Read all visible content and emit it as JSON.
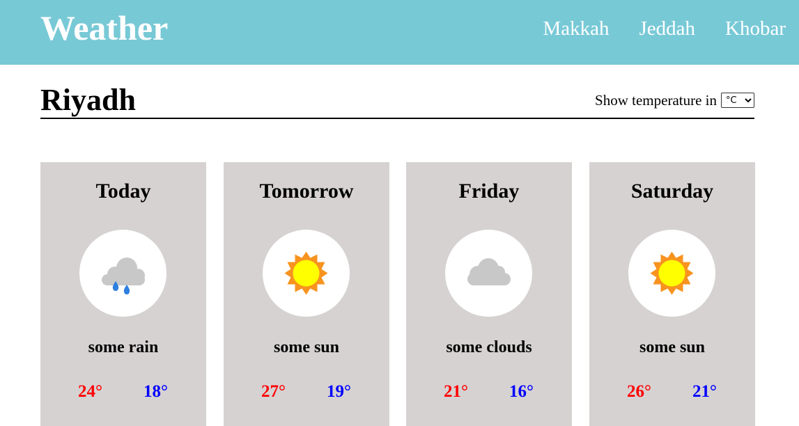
{
  "header": {
    "logo": "Weather",
    "nav": [
      "Makkah",
      "Jeddah",
      "Khobar"
    ]
  },
  "city": {
    "name": "Riyadh",
    "unit_label": "Show temperature in",
    "unit_selected": "°C"
  },
  "forecast": [
    {
      "day": "Today",
      "icon": "rain-cloud-icon",
      "desc": "some rain",
      "high": "24°",
      "low": "18°"
    },
    {
      "day": "Tomorrow",
      "icon": "sun-icon",
      "desc": "some sun",
      "high": "27°",
      "low": "19°"
    },
    {
      "day": "Friday",
      "icon": "cloud-icon",
      "desc": "some clouds",
      "high": "21°",
      "low": "16°"
    },
    {
      "day": "Saturday",
      "icon": "sun-icon",
      "desc": "some sun",
      "high": "26°",
      "low": "21°"
    }
  ],
  "colors": {
    "header_bg": "#78c9d6",
    "card_bg": "#d6d2d2",
    "high_temp": "#ff0000",
    "low_temp": "#0000ff",
    "sun": "#ffff00",
    "sun_rays": "#f7931e",
    "cloud": "#c8c8c8",
    "rain": "#2f7fe0"
  }
}
